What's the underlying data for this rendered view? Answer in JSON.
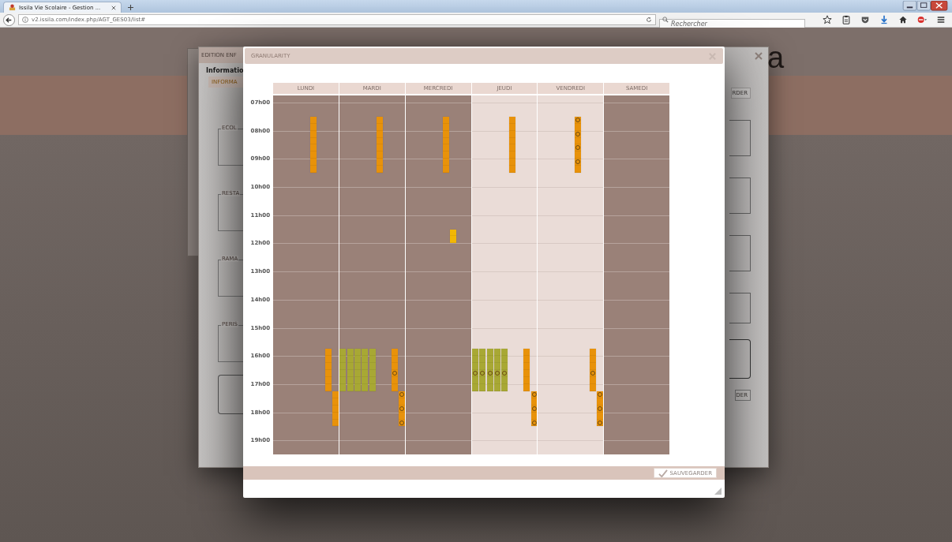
{
  "browser": {
    "tab_title": "Issila Vie Scolaire - Gestion ...",
    "url": "v2.issila.com/index.php/AGT_GES03/list#",
    "search": {
      "placeholder": "Rechercher"
    }
  },
  "back_dialog": {
    "title": "EDITION ENF",
    "heading": "Informatio",
    "tab": "INFORMA",
    "sections": [
      "ECOL",
      "RESTA",
      "RAMA",
      "PERIS"
    ],
    "buttons": [
      "RDER",
      "DER"
    ],
    "logo_fragment": "a"
  },
  "modal": {
    "title": "GRANULARITY",
    "save_button": "SAUVEGARDER",
    "hours": [
      "07h00",
      "08h00",
      "09h00",
      "10h00",
      "11h00",
      "12h00",
      "13h00",
      "14h00",
      "15h00",
      "16h00",
      "17h00",
      "18h00",
      "19h00"
    ],
    "days": [
      {
        "label": "LUNDI",
        "highlighted": false,
        "blocks": [
          {
            "kind": "morning",
            "color": "#e8920a",
            "segments": [
              {
                "marked": false
              },
              {
                "marked": false
              },
              {
                "marked": false
              },
              {
                "marked": false
              },
              {
                "marked": false
              },
              {
                "marked": false
              },
              {
                "marked": false
              },
              {
                "marked": false
              }
            ]
          },
          {
            "kind": "afternoon",
            "color": "#e8920a",
            "segments": [
              {
                "marked": false
              },
              {
                "marked": false
              },
              {
                "marked": false
              },
              {
                "marked": false
              },
              {
                "marked": false
              },
              {
                "marked": false
              }
            ]
          },
          {
            "kind": "evening",
            "color": "#e8920a",
            "segments": [
              {
                "marked": false
              },
              {
                "marked": false
              },
              {
                "marked": false
              },
              {
                "marked": false
              },
              {
                "marked": false
              }
            ]
          }
        ]
      },
      {
        "label": "MARDI",
        "highlighted": false,
        "blocks": [
          {
            "kind": "morning",
            "color": "#e8920a",
            "segments": [
              {
                "marked": false
              },
              {
                "marked": false
              },
              {
                "marked": false
              },
              {
                "marked": false
              },
              {
                "marked": false
              },
              {
                "marked": false
              },
              {
                "marked": false
              },
              {
                "marked": false
              }
            ]
          },
          {
            "kind": "group",
            "color": "#a8a834",
            "bars": [
              {
                "segments": [
                  {
                    "marked": false
                  },
                  {
                    "marked": false
                  },
                  {
                    "marked": false
                  },
                  {
                    "marked": false
                  },
                  {
                    "marked": false
                  },
                  {
                    "marked": false
                  }
                ]
              },
              {
                "segments": [
                  {
                    "marked": false
                  },
                  {
                    "marked": false
                  },
                  {
                    "marked": false
                  },
                  {
                    "marked": false
                  },
                  {
                    "marked": false
                  },
                  {
                    "marked": false
                  }
                ]
              },
              {
                "segments": [
                  {
                    "marked": false
                  },
                  {
                    "marked": false
                  },
                  {
                    "marked": false
                  },
                  {
                    "marked": false
                  },
                  {
                    "marked": false
                  },
                  {
                    "marked": false
                  }
                ]
              },
              {
                "segments": [
                  {
                    "marked": false
                  },
                  {
                    "marked": false
                  },
                  {
                    "marked": false
                  },
                  {
                    "marked": false
                  },
                  {
                    "marked": false
                  },
                  {
                    "marked": false
                  }
                ]
              },
              {
                "segments": [
                  {
                    "marked": false
                  },
                  {
                    "marked": false
                  },
                  {
                    "marked": false
                  },
                  {
                    "marked": false
                  },
                  {
                    "marked": false
                  },
                  {
                    "marked": false
                  }
                ]
              }
            ]
          },
          {
            "kind": "afternoon",
            "color": "#e8920a",
            "segments": [
              {
                "marked": false
              },
              {
                "marked": false
              },
              {
                "marked": false
              },
              {
                "marked": true
              },
              {
                "marked": false
              },
              {
                "marked": false
              }
            ]
          },
          {
            "kind": "evening",
            "color": "#e8920a",
            "segments": [
              {
                "marked": true
              },
              {
                "marked": false
              },
              {
                "marked": true
              },
              {
                "marked": false
              },
              {
                "marked": true
              }
            ]
          }
        ]
      },
      {
        "label": "MERCREDI",
        "highlighted": false,
        "blocks": [
          {
            "kind": "morning",
            "color": "#e8920a",
            "segments": [
              {
                "marked": false
              },
              {
                "marked": false
              },
              {
                "marked": false
              },
              {
                "marked": false
              },
              {
                "marked": false
              },
              {
                "marked": false
              },
              {
                "marked": false
              },
              {
                "marked": false
              }
            ]
          },
          {
            "kind": "noon",
            "color": "#f2b705",
            "segments": [
              {
                "marked": false
              },
              {
                "marked": false
              }
            ]
          }
        ]
      },
      {
        "label": "JEUDI",
        "highlighted": true,
        "blocks": [
          {
            "kind": "morning",
            "color": "#e8920a",
            "segments": [
              {
                "marked": false
              },
              {
                "marked": false
              },
              {
                "marked": false
              },
              {
                "marked": false
              },
              {
                "marked": false
              },
              {
                "marked": false
              },
              {
                "marked": false
              },
              {
                "marked": false
              }
            ]
          },
          {
            "kind": "group",
            "color": "#a8a834",
            "bars": [
              {
                "segments": [
                  {
                    "marked": false
                  },
                  {
                    "marked": false
                  },
                  {
                    "marked": false
                  },
                  {
                    "marked": true
                  },
                  {
                    "marked": false
                  },
                  {
                    "marked": false
                  }
                ]
              },
              {
                "segments": [
                  {
                    "marked": false
                  },
                  {
                    "marked": false
                  },
                  {
                    "marked": false
                  },
                  {
                    "marked": true
                  },
                  {
                    "marked": false
                  },
                  {
                    "marked": false
                  }
                ]
              },
              {
                "segments": [
                  {
                    "marked": false
                  },
                  {
                    "marked": false
                  },
                  {
                    "marked": false
                  },
                  {
                    "marked": true
                  },
                  {
                    "marked": false
                  },
                  {
                    "marked": false
                  }
                ]
              },
              {
                "segments": [
                  {
                    "marked": false
                  },
                  {
                    "marked": false
                  },
                  {
                    "marked": false
                  },
                  {
                    "marked": true
                  },
                  {
                    "marked": false
                  },
                  {
                    "marked": false
                  }
                ]
              },
              {
                "segments": [
                  {
                    "marked": false
                  },
                  {
                    "marked": false
                  },
                  {
                    "marked": false
                  },
                  {
                    "marked": true
                  },
                  {
                    "marked": false
                  },
                  {
                    "marked": false
                  }
                ]
              }
            ]
          },
          {
            "kind": "afternoon",
            "color": "#e8920a",
            "segments": [
              {
                "marked": false
              },
              {
                "marked": false
              },
              {
                "marked": false
              },
              {
                "marked": false
              },
              {
                "marked": false
              },
              {
                "marked": false
              }
            ]
          },
          {
            "kind": "evening",
            "color": "#e8920a",
            "segments": [
              {
                "marked": true
              },
              {
                "marked": false
              },
              {
                "marked": true
              },
              {
                "marked": false
              },
              {
                "marked": true
              }
            ]
          }
        ]
      },
      {
        "label": "VENDREDI",
        "highlighted": true,
        "blocks": [
          {
            "kind": "morning",
            "color": "#e8920a",
            "segments": [
              {
                "marked": true
              },
              {
                "marked": false
              },
              {
                "marked": true
              },
              {
                "marked": false
              },
              {
                "marked": true
              },
              {
                "marked": false
              },
              {
                "marked": true
              },
              {
                "marked": false
              }
            ]
          },
          {
            "kind": "afternoon",
            "color": "#e8920a",
            "segments": [
              {
                "marked": false
              },
              {
                "marked": false
              },
              {
                "marked": false
              },
              {
                "marked": true
              },
              {
                "marked": false
              },
              {
                "marked": false
              }
            ]
          },
          {
            "kind": "evening",
            "color": "#e8920a",
            "segments": [
              {
                "marked": true
              },
              {
                "marked": false
              },
              {
                "marked": true
              },
              {
                "marked": false
              },
              {
                "marked": true
              }
            ]
          }
        ]
      },
      {
        "label": "SAMEDI",
        "highlighted": false
      }
    ]
  }
}
